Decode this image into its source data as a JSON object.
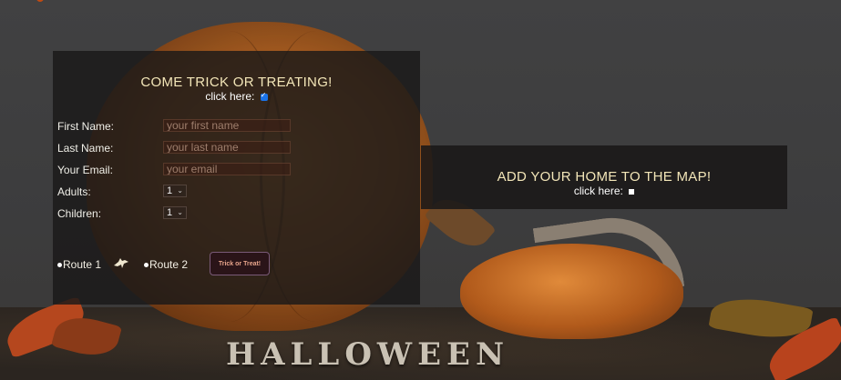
{
  "trick_panel": {
    "title": "COME TRICK OR TREATING!",
    "click_label": "click here:",
    "checkbox_checked": true,
    "fields": {
      "first_name": {
        "label": "First Name:",
        "placeholder": "your first name"
      },
      "last_name": {
        "label": "Last Name:",
        "placeholder": "your last name"
      },
      "email": {
        "label": "Your Email:",
        "placeholder": "your email"
      },
      "adults": {
        "label": "Adults:",
        "value": "1"
      },
      "children": {
        "label": "Children:",
        "value": "1"
      }
    },
    "routes": [
      {
        "label": "Route 1"
      },
      {
        "label": "Route 2"
      }
    ],
    "submit_label": "Trick or Treat!"
  },
  "home_panel": {
    "title": "ADD YOUR HOME TO THE MAP!",
    "click_label": "click here:",
    "checkbox_checked": false
  },
  "background": {
    "word": "HALLOWEEN"
  },
  "colors": {
    "title_text": "#f3e6b8",
    "panel_bg": "#1a1818",
    "button_text": "#e6a38a",
    "checkbox_accent": "#1a73e8"
  }
}
